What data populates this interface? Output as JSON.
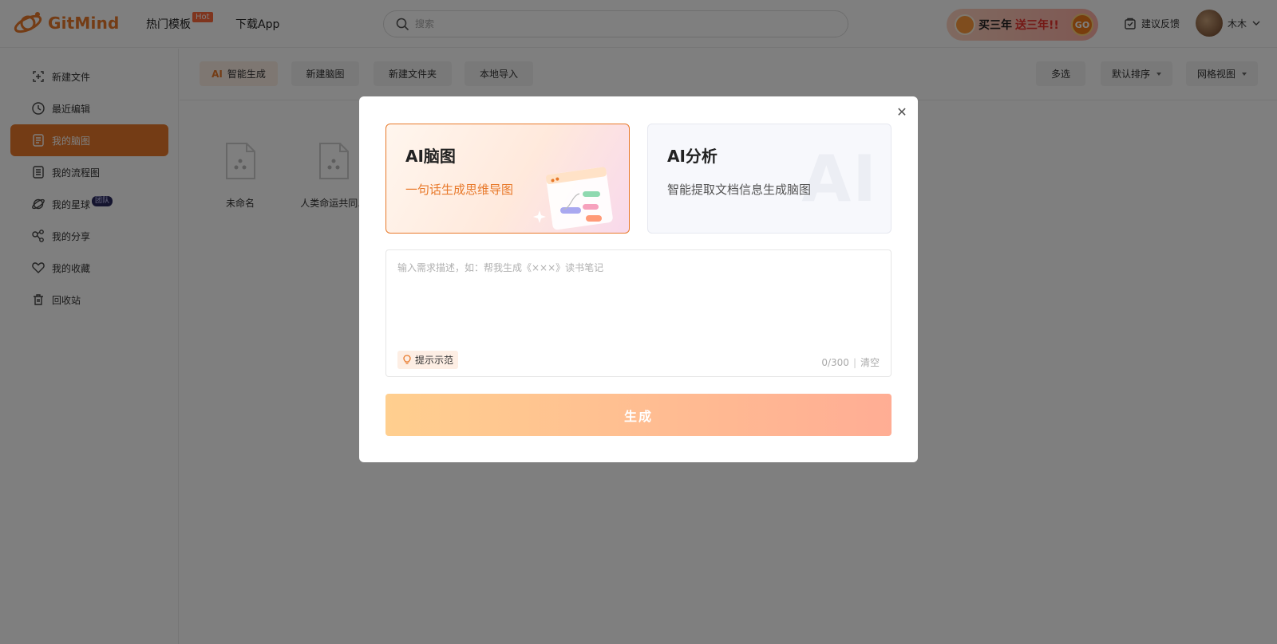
{
  "header": {
    "logo_text": "GitMind",
    "nav": [
      {
        "label": "热门模板",
        "badge": "Hot"
      },
      {
        "label": "下载App"
      }
    ],
    "search_placeholder": "搜索",
    "promo": {
      "text_a": "买三年",
      "text_b": "送三年!!",
      "go": "GO"
    },
    "feedback_label": "建议反馈",
    "user_name": "木木"
  },
  "sidebar": {
    "items": [
      {
        "label": "新建文件",
        "icon": "new-file-icon"
      },
      {
        "label": "最近编辑",
        "icon": "clock-icon"
      },
      {
        "label": "我的脑图",
        "icon": "document-icon",
        "active": true
      },
      {
        "label": "我的流程图",
        "icon": "flowchart-icon"
      },
      {
        "label": "我的星球",
        "icon": "planet-icon",
        "badge": "团队"
      },
      {
        "label": "我的分享",
        "icon": "share-icon"
      },
      {
        "label": "我的收藏",
        "icon": "heart-icon"
      },
      {
        "label": "回收站",
        "icon": "trash-icon"
      }
    ]
  },
  "toolbar": {
    "ai_icon": "AI",
    "ai_generate": "智能生成",
    "new_mindmap": "新建脑图",
    "new_folder": "新建文件夹",
    "local_import": "本地导入",
    "multi_select": "多选",
    "sort": "默认排序",
    "view": "网格视图"
  },
  "files": [
    {
      "name": "未命名"
    },
    {
      "name": "人类命运共同..."
    }
  ],
  "modal": {
    "cards": [
      {
        "title": "AI脑图",
        "subtitle": "一句话生成思维导图"
      },
      {
        "title": "AI分析",
        "subtitle": "智能提取文档信息生成脑图",
        "watermark": "AI"
      }
    ],
    "input_placeholder": "输入需求描述，如：帮我生成《×××》读书笔记",
    "hint_label": "提示示范",
    "counter": "0/300",
    "clear_label": "清空",
    "generate_label": "生成"
  },
  "colors": {
    "accent": "#e8792a",
    "overlay": "rgba(0,0,0,0.5)"
  }
}
